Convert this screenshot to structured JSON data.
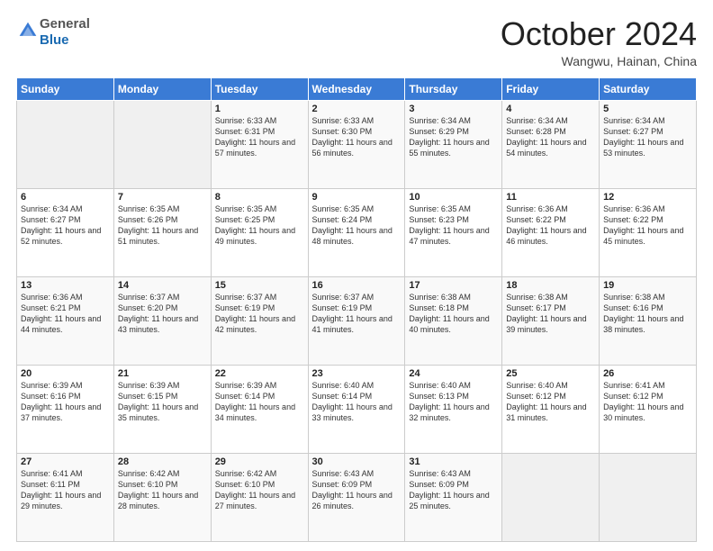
{
  "header": {
    "logo_line1": "General",
    "logo_line2": "Blue",
    "month": "October 2024",
    "location": "Wangwu, Hainan, China"
  },
  "weekdays": [
    "Sunday",
    "Monday",
    "Tuesday",
    "Wednesday",
    "Thursday",
    "Friday",
    "Saturday"
  ],
  "weeks": [
    [
      {
        "day": "",
        "text": ""
      },
      {
        "day": "",
        "text": ""
      },
      {
        "day": "1",
        "text": "Sunrise: 6:33 AM\nSunset: 6:31 PM\nDaylight: 11 hours and 57 minutes."
      },
      {
        "day": "2",
        "text": "Sunrise: 6:33 AM\nSunset: 6:30 PM\nDaylight: 11 hours and 56 minutes."
      },
      {
        "day": "3",
        "text": "Sunrise: 6:34 AM\nSunset: 6:29 PM\nDaylight: 11 hours and 55 minutes."
      },
      {
        "day": "4",
        "text": "Sunrise: 6:34 AM\nSunset: 6:28 PM\nDaylight: 11 hours and 54 minutes."
      },
      {
        "day": "5",
        "text": "Sunrise: 6:34 AM\nSunset: 6:27 PM\nDaylight: 11 hours and 53 minutes."
      }
    ],
    [
      {
        "day": "6",
        "text": "Sunrise: 6:34 AM\nSunset: 6:27 PM\nDaylight: 11 hours and 52 minutes."
      },
      {
        "day": "7",
        "text": "Sunrise: 6:35 AM\nSunset: 6:26 PM\nDaylight: 11 hours and 51 minutes."
      },
      {
        "day": "8",
        "text": "Sunrise: 6:35 AM\nSunset: 6:25 PM\nDaylight: 11 hours and 49 minutes."
      },
      {
        "day": "9",
        "text": "Sunrise: 6:35 AM\nSunset: 6:24 PM\nDaylight: 11 hours and 48 minutes."
      },
      {
        "day": "10",
        "text": "Sunrise: 6:35 AM\nSunset: 6:23 PM\nDaylight: 11 hours and 47 minutes."
      },
      {
        "day": "11",
        "text": "Sunrise: 6:36 AM\nSunset: 6:22 PM\nDaylight: 11 hours and 46 minutes."
      },
      {
        "day": "12",
        "text": "Sunrise: 6:36 AM\nSunset: 6:22 PM\nDaylight: 11 hours and 45 minutes."
      }
    ],
    [
      {
        "day": "13",
        "text": "Sunrise: 6:36 AM\nSunset: 6:21 PM\nDaylight: 11 hours and 44 minutes."
      },
      {
        "day": "14",
        "text": "Sunrise: 6:37 AM\nSunset: 6:20 PM\nDaylight: 11 hours and 43 minutes."
      },
      {
        "day": "15",
        "text": "Sunrise: 6:37 AM\nSunset: 6:19 PM\nDaylight: 11 hours and 42 minutes."
      },
      {
        "day": "16",
        "text": "Sunrise: 6:37 AM\nSunset: 6:19 PM\nDaylight: 11 hours and 41 minutes."
      },
      {
        "day": "17",
        "text": "Sunrise: 6:38 AM\nSunset: 6:18 PM\nDaylight: 11 hours and 40 minutes."
      },
      {
        "day": "18",
        "text": "Sunrise: 6:38 AM\nSunset: 6:17 PM\nDaylight: 11 hours and 39 minutes."
      },
      {
        "day": "19",
        "text": "Sunrise: 6:38 AM\nSunset: 6:16 PM\nDaylight: 11 hours and 38 minutes."
      }
    ],
    [
      {
        "day": "20",
        "text": "Sunrise: 6:39 AM\nSunset: 6:16 PM\nDaylight: 11 hours and 37 minutes."
      },
      {
        "day": "21",
        "text": "Sunrise: 6:39 AM\nSunset: 6:15 PM\nDaylight: 11 hours and 35 minutes."
      },
      {
        "day": "22",
        "text": "Sunrise: 6:39 AM\nSunset: 6:14 PM\nDaylight: 11 hours and 34 minutes."
      },
      {
        "day": "23",
        "text": "Sunrise: 6:40 AM\nSunset: 6:14 PM\nDaylight: 11 hours and 33 minutes."
      },
      {
        "day": "24",
        "text": "Sunrise: 6:40 AM\nSunset: 6:13 PM\nDaylight: 11 hours and 32 minutes."
      },
      {
        "day": "25",
        "text": "Sunrise: 6:40 AM\nSunset: 6:12 PM\nDaylight: 11 hours and 31 minutes."
      },
      {
        "day": "26",
        "text": "Sunrise: 6:41 AM\nSunset: 6:12 PM\nDaylight: 11 hours and 30 minutes."
      }
    ],
    [
      {
        "day": "27",
        "text": "Sunrise: 6:41 AM\nSunset: 6:11 PM\nDaylight: 11 hours and 29 minutes."
      },
      {
        "day": "28",
        "text": "Sunrise: 6:42 AM\nSunset: 6:10 PM\nDaylight: 11 hours and 28 minutes."
      },
      {
        "day": "29",
        "text": "Sunrise: 6:42 AM\nSunset: 6:10 PM\nDaylight: 11 hours and 27 minutes."
      },
      {
        "day": "30",
        "text": "Sunrise: 6:43 AM\nSunset: 6:09 PM\nDaylight: 11 hours and 26 minutes."
      },
      {
        "day": "31",
        "text": "Sunrise: 6:43 AM\nSunset: 6:09 PM\nDaylight: 11 hours and 25 minutes."
      },
      {
        "day": "",
        "text": ""
      },
      {
        "day": "",
        "text": ""
      }
    ]
  ]
}
